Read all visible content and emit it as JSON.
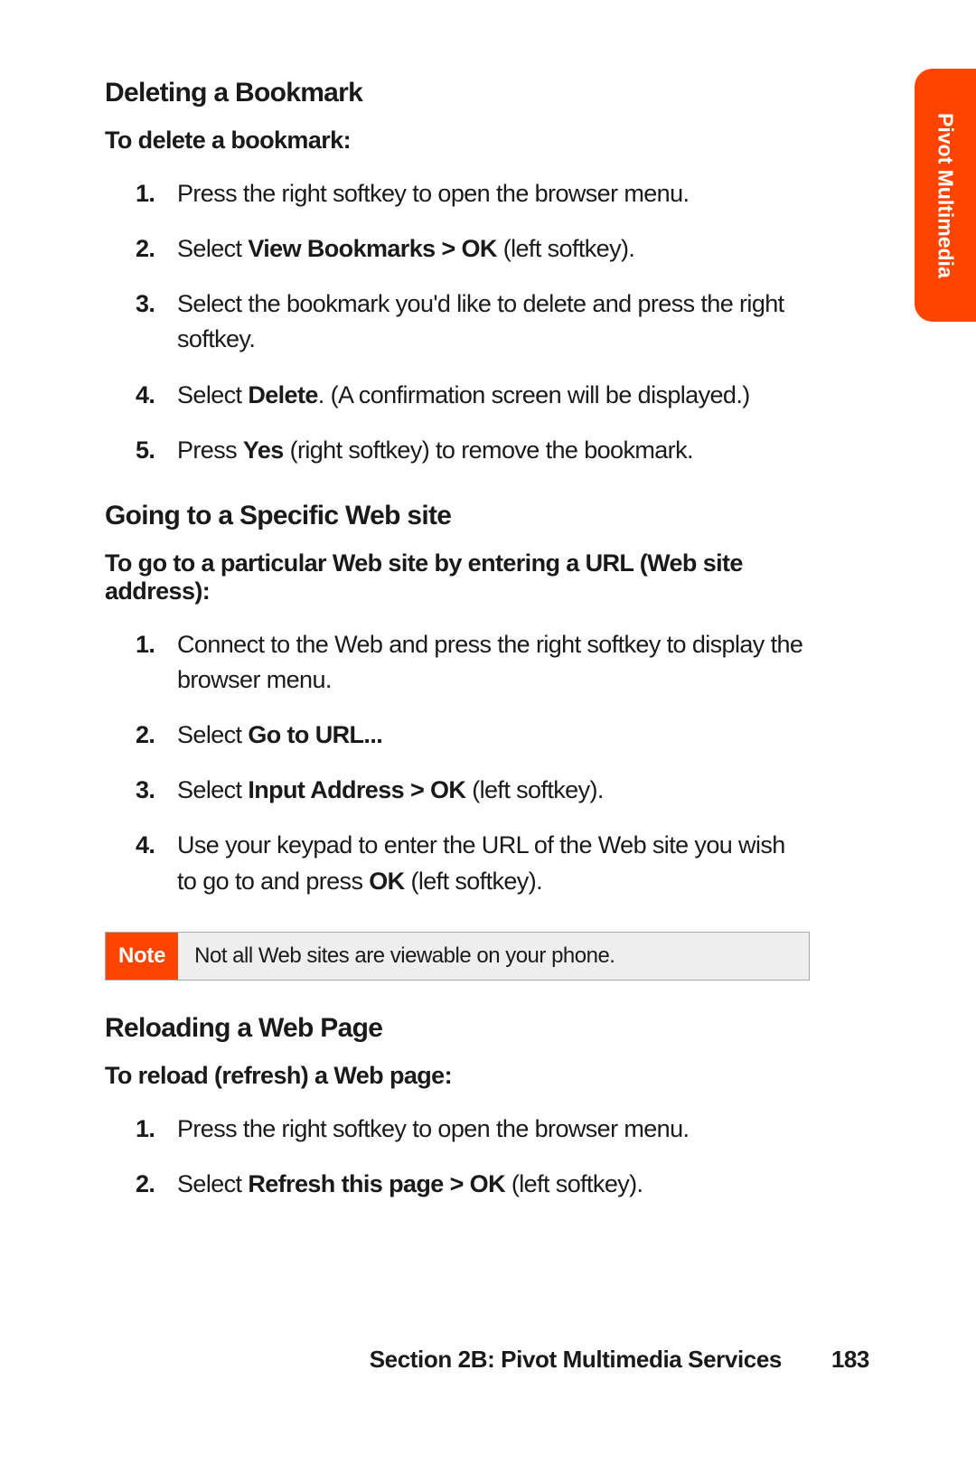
{
  "side_tab": "Pivot Multimedia",
  "sections": [
    {
      "heading": "Deleting a Bookmark",
      "subheading": "To delete a bookmark:",
      "steps": [
        {
          "num": "1.",
          "parts": [
            {
              "t": "Press the right softkey to open the browser menu."
            }
          ]
        },
        {
          "num": "2.",
          "parts": [
            {
              "t": "Select "
            },
            {
              "t": "View Bookmarks > OK",
              "b": true
            },
            {
              "t": " (left softkey)."
            }
          ]
        },
        {
          "num": "3.",
          "parts": [
            {
              "t": "Select the bookmark you'd like to delete and press the right softkey."
            }
          ]
        },
        {
          "num": "4.",
          "parts": [
            {
              "t": "Select "
            },
            {
              "t": "Delete",
              "b": true
            },
            {
              "t": ". (A confirmation screen will be displayed.)"
            }
          ]
        },
        {
          "num": "5.",
          "parts": [
            {
              "t": "Press "
            },
            {
              "t": "Yes",
              "b": true
            },
            {
              "t": " (right softkey) to remove the bookmark."
            }
          ]
        }
      ]
    },
    {
      "heading": "Going to a Specific Web site",
      "subheading": "To go to a particular Web site by entering a URL (Web site address):",
      "steps": [
        {
          "num": "1.",
          "parts": [
            {
              "t": "Connect to the Web and press the right softkey to display the browser menu."
            }
          ]
        },
        {
          "num": "2.",
          "parts": [
            {
              "t": "Select "
            },
            {
              "t": "Go to URL...",
              "b": true
            }
          ]
        },
        {
          "num": "3.",
          "parts": [
            {
              "t": "Select "
            },
            {
              "t": "Input Address > OK",
              "b": true
            },
            {
              "t": " (left softkey)."
            }
          ]
        },
        {
          "num": "4.",
          "parts": [
            {
              "t": "Use your keypad to enter the URL of the Web site you wish to go to and press "
            },
            {
              "t": "OK",
              "b": true
            },
            {
              "t": " (left softkey)."
            }
          ]
        }
      ],
      "note": {
        "label": "Note",
        "text": "Not all Web sites are viewable on your phone."
      }
    },
    {
      "heading": "Reloading a Web Page",
      "subheading": "To reload (refresh) a Web page:",
      "steps": [
        {
          "num": "1.",
          "parts": [
            {
              "t": "Press the right softkey to open the browser menu."
            }
          ]
        },
        {
          "num": "2.",
          "parts": [
            {
              "t": "Select "
            },
            {
              "t": "Refresh this page > OK",
              "b": true
            },
            {
              "t": " (left softkey)."
            }
          ]
        }
      ]
    }
  ],
  "footer": {
    "section_label": "Section 2B: Pivot Multimedia Services",
    "page_number": "183"
  }
}
